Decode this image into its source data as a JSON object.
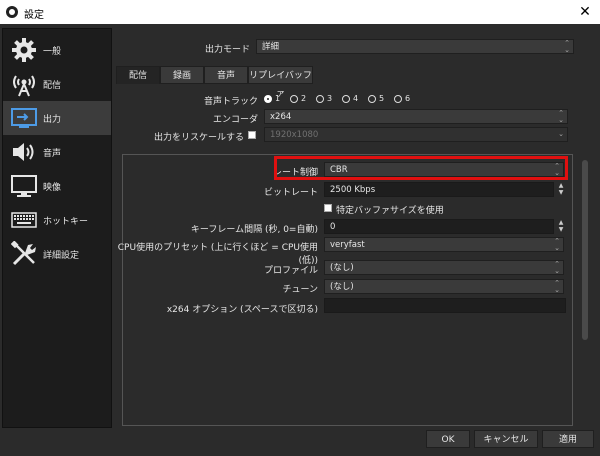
{
  "window": {
    "title": "設定",
    "close_glyph": "✕"
  },
  "sidebar": {
    "items": [
      {
        "label": "一般",
        "icon": "gear-icon"
      },
      {
        "label": "配信",
        "icon": "antenna-icon"
      },
      {
        "label": "出力",
        "icon": "output-icon",
        "active": true
      },
      {
        "label": "音声",
        "icon": "speaker-icon"
      },
      {
        "label": "映像",
        "icon": "monitor-icon"
      },
      {
        "label": "ホットキー",
        "icon": "keyboard-icon"
      },
      {
        "label": "詳細設定",
        "icon": "tools-icon"
      }
    ]
  },
  "output_mode": {
    "label": "出力モード",
    "value": "詳細"
  },
  "tabs": [
    "配信",
    "録画",
    "音声",
    "リプレイバッファ"
  ],
  "audio_track": {
    "label": "音声トラック",
    "options": [
      "1",
      "2",
      "3",
      "4",
      "5",
      "6"
    ],
    "selected": "1"
  },
  "encoder": {
    "label": "エンコーダ",
    "value": "x264"
  },
  "rescale": {
    "label": "出力をリスケールする",
    "value": "1920x1080"
  },
  "rate_control": {
    "label": "レート制御",
    "value": "CBR"
  },
  "bitrate": {
    "label": "ビットレート",
    "value": "2500 Kbps"
  },
  "custom_buffer": {
    "label": "特定バッファサイズを使用"
  },
  "keyframe": {
    "label": "キーフレーム間隔 (秒, 0=自動)",
    "value": "0"
  },
  "cpu_preset": {
    "label": "CPU使用のプリセット (上に行くほど = CPU使用(低))",
    "value": "veryfast"
  },
  "profile": {
    "label": "プロファイル",
    "value": "(なし)"
  },
  "tune": {
    "label": "チューン",
    "value": "(なし)"
  },
  "x264_opts": {
    "label": "x264 オプション (スペースで区切る)",
    "value": ""
  },
  "buttons": {
    "ok": "OK",
    "cancel": "キャンセル",
    "apply": "適用"
  },
  "colors": {
    "highlight": "#e01010",
    "background": "#2b2b2b"
  }
}
